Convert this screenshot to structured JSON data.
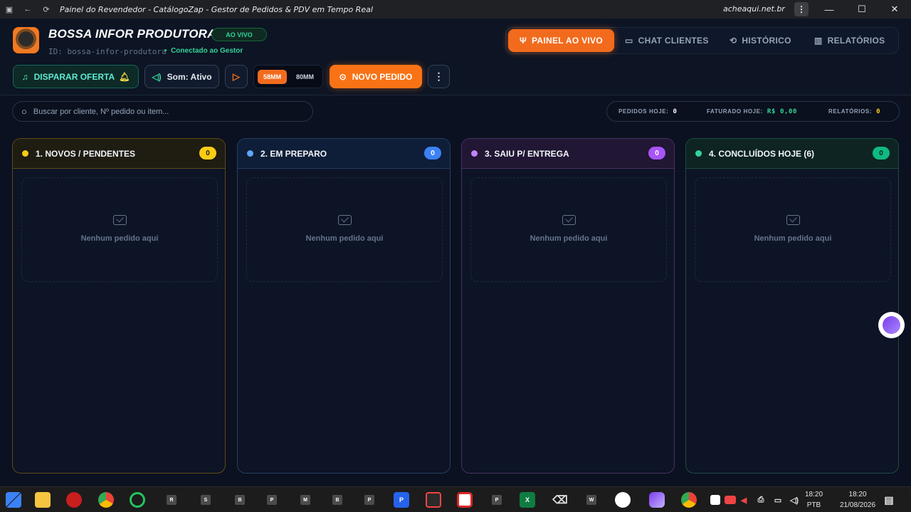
{
  "window": {
    "title": "Painel do Revendedor - CatálogoZap - Gestor de Pedidos & PDV em Tempo Real",
    "domain": "acheaqui.net.br"
  },
  "header": {
    "brand": "BOSSA INFOR PRODUTORA",
    "live_badge": "AO VIVO",
    "store_id": "ID: bossa-infor-produtora",
    "separator": "•",
    "connection_status": "Conectado ao Gestor"
  },
  "nav": {
    "live_panel": "PAINEL AO VIVO",
    "chat": "CHAT CLIENTES",
    "history": "HISTÓRICO",
    "reports": "RELATÓRIOS"
  },
  "toolbar": {
    "offer": "DISPARAR OFERTA",
    "sound": "Som: Ativo",
    "paper_options": [
      "58MM",
      "80MM"
    ],
    "paper_selected": "58MM",
    "new_order": "NOVO PEDIDO"
  },
  "search": {
    "placeholder": "Buscar por cliente, Nº pedido ou item..."
  },
  "stats": {
    "orders_label": "PEDIDOS HOJE:",
    "orders_value": "0",
    "revenue_label": "FATURADO HOJE:",
    "revenue_value": "R$ 0,00",
    "reports_label": "RELATÓRIOS:",
    "reports_value": "0"
  },
  "columns": [
    {
      "title": "1. NOVOS / PENDENTES",
      "count": "0",
      "empty": "Nenhum pedido aqui"
    },
    {
      "title": "2. EM PREPARO",
      "count": "0",
      "empty": "Nenhum pedido aqui"
    },
    {
      "title": "3. SAIU P/ ENTREGA",
      "count": "0",
      "empty": "Nenhum pedido aqui"
    },
    {
      "title": "4. CONCLUÍDOS HOJE (6)",
      "count": "0",
      "empty": "Nenhum pedido aqui"
    }
  ],
  "taskbar": {
    "time": "18:20",
    "lang": "PTB",
    "date": "21/08/2026",
    "letters": [
      "R",
      "S",
      "B",
      "P",
      "M",
      "B",
      "P",
      "P",
      "W"
    ]
  },
  "colors": {
    "accent": "#f97316",
    "live_green": "#34d399",
    "pending": "#facc15",
    "preparing": "#3b82f6",
    "delivering": "#a855f7",
    "done": "#10b981"
  }
}
